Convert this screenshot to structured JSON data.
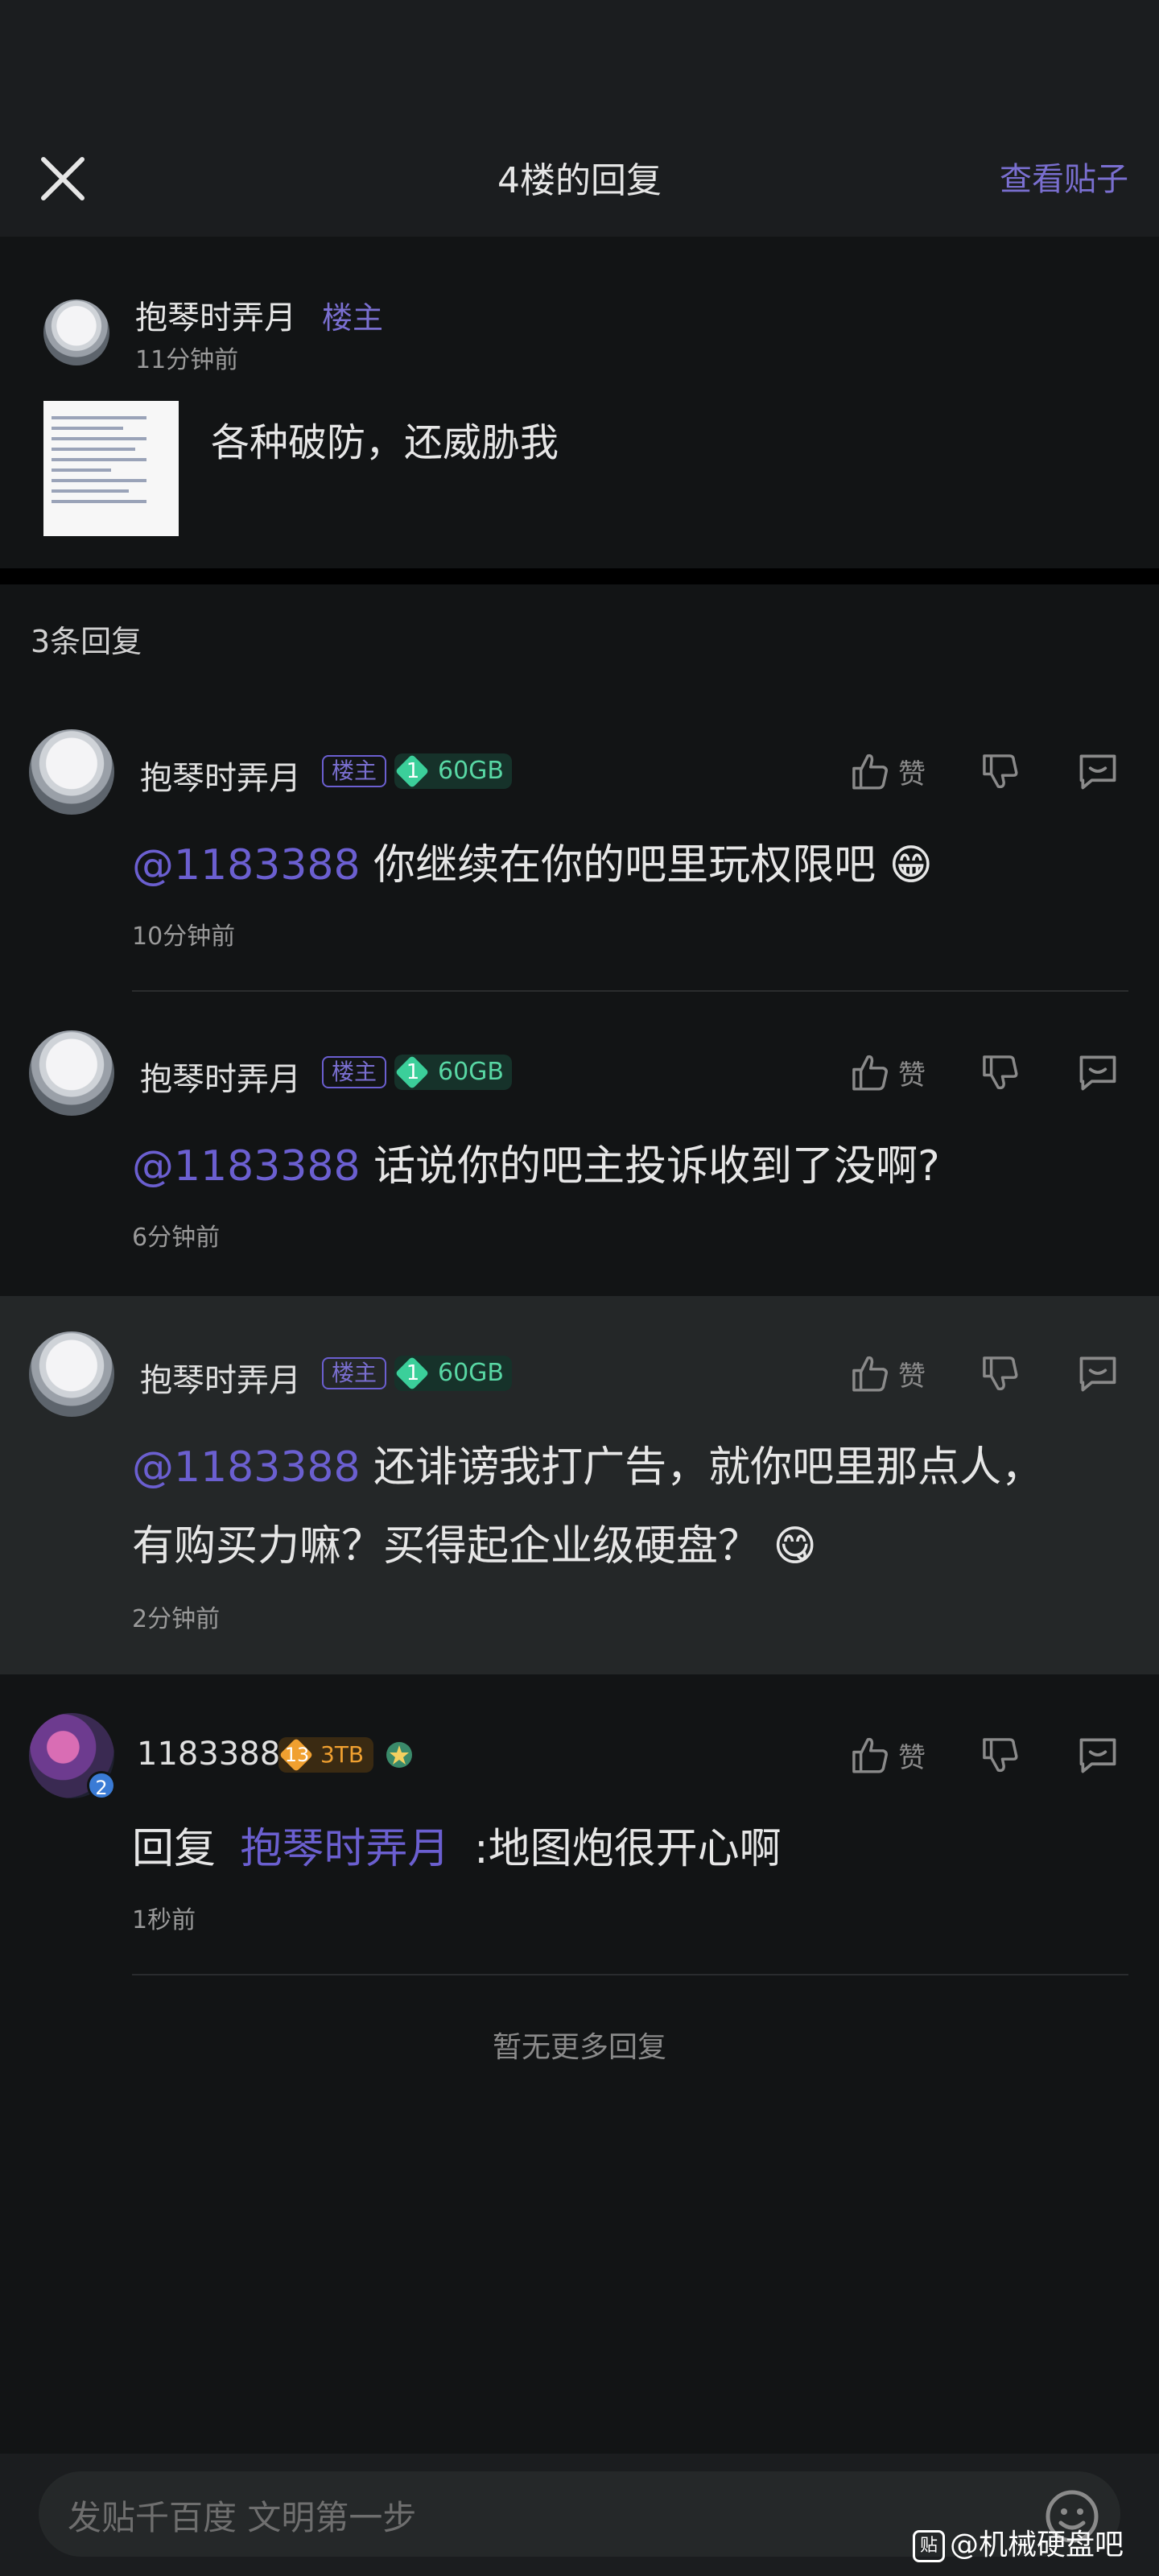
{
  "header": {
    "title": "4楼的回复",
    "view_post": "查看贴子"
  },
  "post": {
    "author": "抱琴时弄月",
    "author_tag": "楼主",
    "time": "11分钟前",
    "text": "各种破防，还威胁我"
  },
  "reply_count": "3条回复",
  "comments": [
    {
      "name": "抱琴时弄月",
      "tag": "楼主",
      "level": "1",
      "storage": "60GB",
      "like": "赞",
      "mention": "@1183388",
      "text": "你继续在你的吧里玩权限吧 😁",
      "time": "10分钟前"
    },
    {
      "name": "抱琴时弄月",
      "tag": "楼主",
      "level": "1",
      "storage": "60GB",
      "like": "赞",
      "mention": "@1183388",
      "text": "话说你的吧主投诉收到了没啊?",
      "time": "6分钟前"
    },
    {
      "name": "抱琴时弄月",
      "tag": "楼主",
      "level": "1",
      "storage": "60GB",
      "like": "赞",
      "mention": "@1183388",
      "text_line1": "还诽谤我打广告，就你吧里那点人，",
      "text_line2": "有购买力嘛？买得起企业级硬盘？ 😋",
      "time": "2分钟前"
    },
    {
      "name": "1183388",
      "level": "13",
      "storage": "3TB",
      "avatar_badge": "2",
      "like": "赞",
      "reply_prefix": "回复",
      "reply_target": "抱琴时弄月",
      "text": ":地图炮很开心啊",
      "time": "1秒前"
    }
  ],
  "no_more": "暂无更多回复",
  "input": {
    "placeholder": "发贴千百度 文明第一步"
  },
  "watermark": {
    "icon_text": "贴",
    "text": "@机械硬盘吧"
  },
  "colors": {
    "accent": "#7a6fd0",
    "level_green": "#58d7a4",
    "level_gold": "#f0a030",
    "background": "#121415"
  }
}
